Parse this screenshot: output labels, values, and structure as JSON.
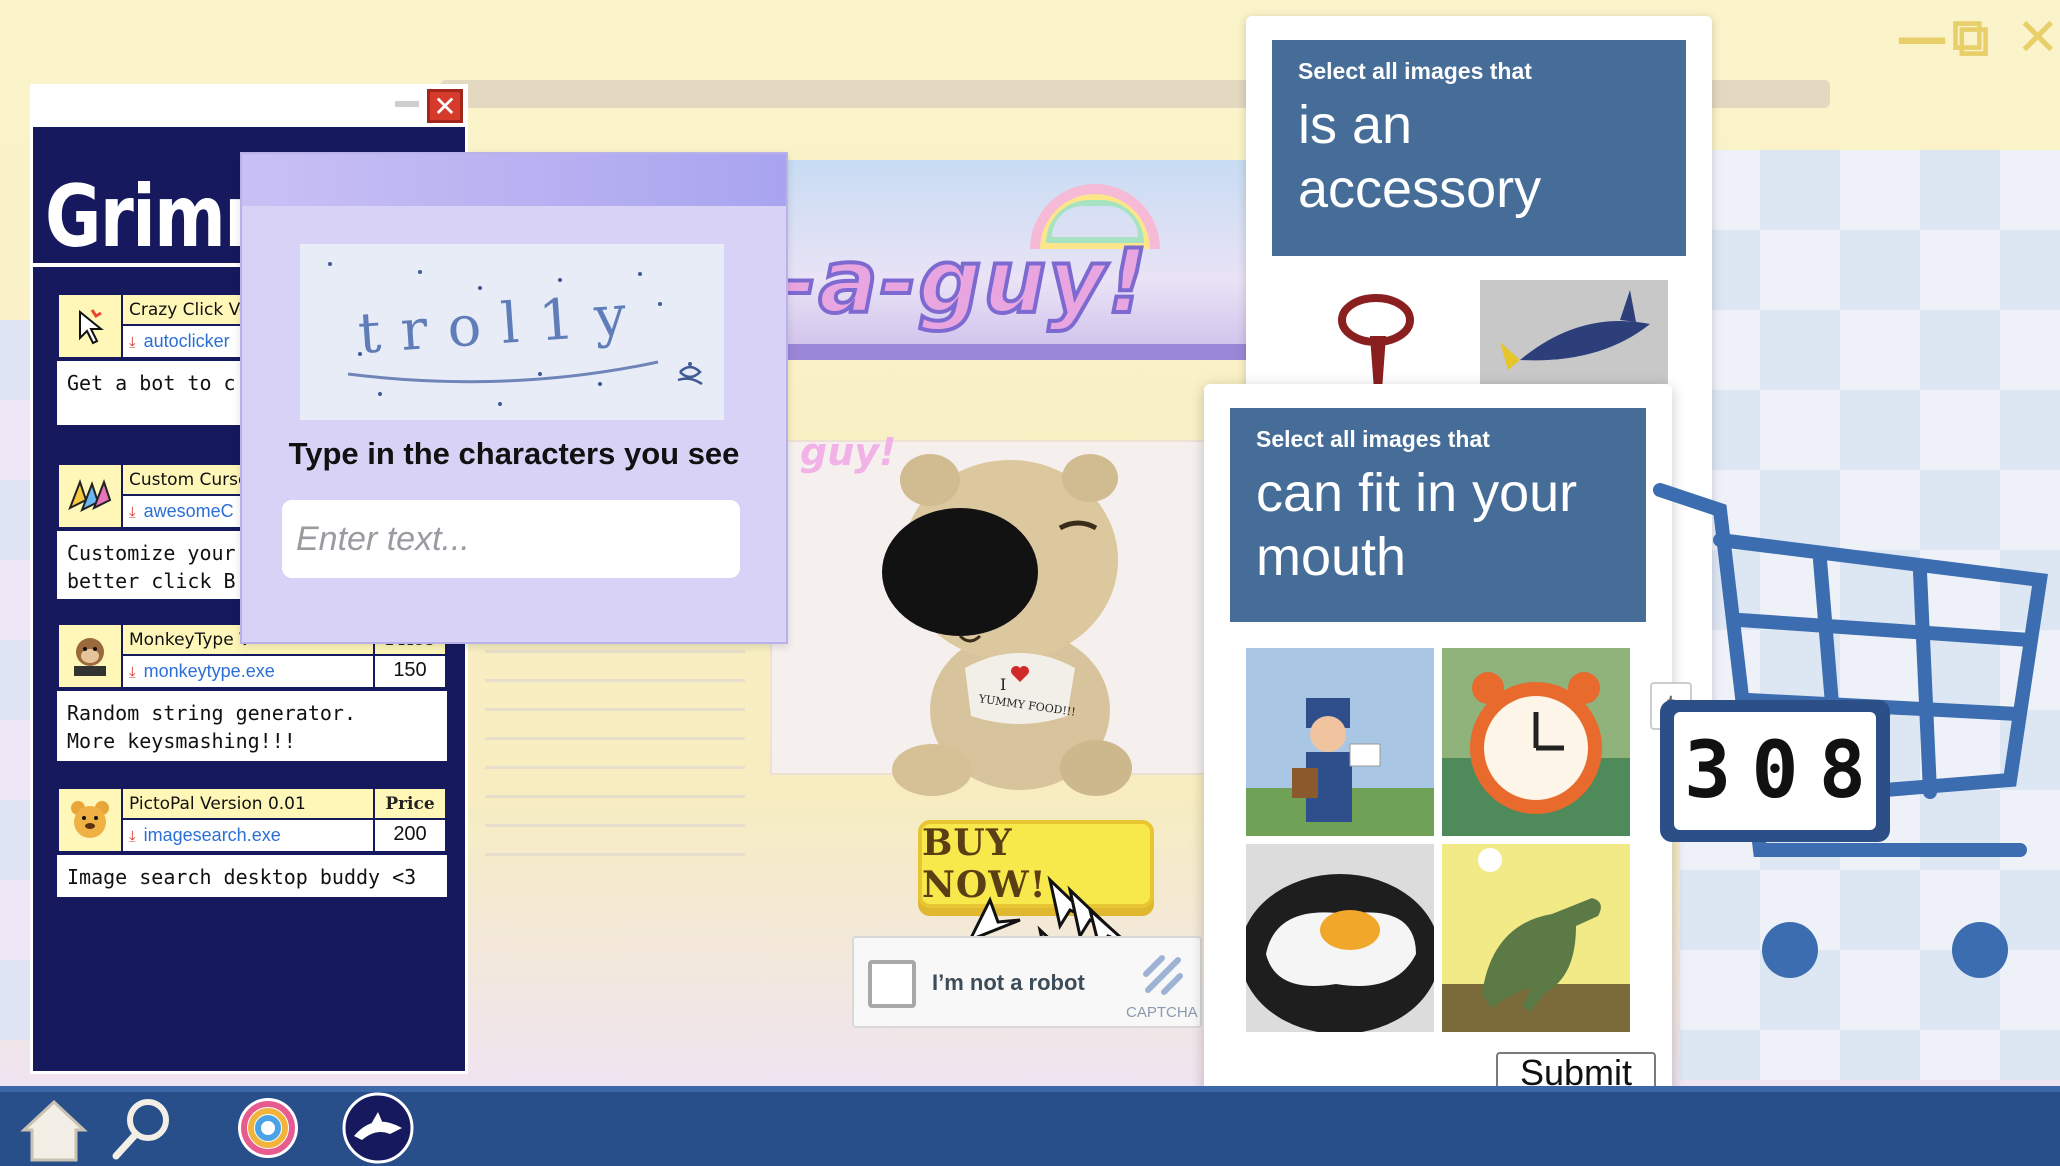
{
  "window_controls": {
    "minimize": "—",
    "maximize": "⧉",
    "close": "✕"
  },
  "store": {
    "banner_text": "-a-guy!",
    "tag_text": "guy!",
    "buy_button": "BUY NOW!",
    "shirt_text_1": "I",
    "shirt_text_2": "YUMMY FOOD!!!"
  },
  "recaptcha": {
    "label": "I’m not a robot",
    "brand": "CAPTCHA"
  },
  "software_window": {
    "title": "Grimm's",
    "close": "✕",
    "items": [
      {
        "name": "Crazy Click Ve",
        "file": "autoclicker",
        "price_header": "",
        "price": "",
        "description": "Get a bot to c",
        "icon": "cursor-click-icon"
      },
      {
        "name": "Custom Cursor",
        "file": "awesomeC",
        "price_header": "",
        "price": "",
        "description": "Customize your\nbetter click B",
        "icon": "colorful-cursors-icon"
      },
      {
        "name": "MonkeyType V",
        "file": "monkeytype.exe",
        "price_header": "Price",
        "price": "150",
        "description": "Random string generator.\nMore keysmashing!!!",
        "icon": "monkey-typing-icon"
      },
      {
        "name": "PictoPal Version 0.01",
        "file": "imagesearch.exe",
        "price_header": "Price",
        "price": "200",
        "description": "Image search desktop buddy <3",
        "icon": "bear-face-icon"
      }
    ]
  },
  "text_captcha": {
    "distorted_text": "trol1y",
    "prompt": "Type in the characters you see",
    "input_placeholder": "Enter text...",
    "input_value": ""
  },
  "image_captcha_back": {
    "instruction": "Select all images that",
    "target": "is an accessory"
  },
  "image_captcha_front": {
    "instruction": "Select all images that",
    "target": "can fit in your mouth",
    "tiles": [
      "mail-carrier",
      "alarm-clock",
      "fried-egg",
      "t-rex-dinosaur"
    ],
    "submit": "Submit"
  },
  "counter": {
    "digits": [
      "3",
      "0",
      "8"
    ],
    "behind_label": "t"
  },
  "taskbar": {
    "items": [
      "home-icon",
      "search-icon",
      "rainbow-ring-icon",
      "bird-app-icon"
    ]
  },
  "colors": {
    "captcha_header": "#456d98",
    "software_bg": "#17195e",
    "taskbar": "#284f8a",
    "buy_button": "#f7e84c"
  }
}
